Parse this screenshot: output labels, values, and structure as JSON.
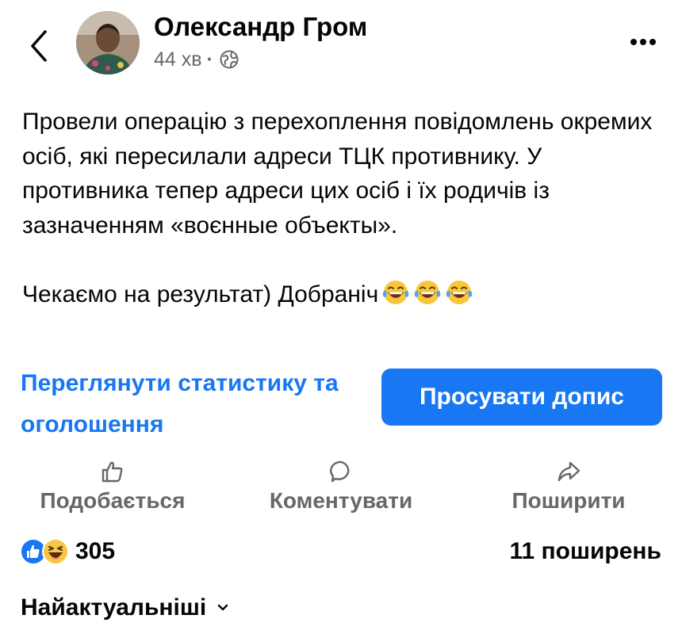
{
  "post": {
    "author": "Олександр Гром",
    "time": "44 хв",
    "paragraph1": "Провели операцію з перехоплення повідомлень окремих осіб, які пересилали адреси ТЦК противнику. У противника тепер адреси цих осіб і їх родичів із зазначенням «воєнные объекты».",
    "paragraph2": "Чекаємо на результат) Добраніч",
    "emojis": [
      "laugh-tears",
      "laugh-tears",
      "laugh-tears"
    ]
  },
  "promo": {
    "stats_link": "Переглянути статистику та оголошення",
    "promote_button": "Просувати допис"
  },
  "actions": {
    "like": "Подобається",
    "comment": "Коментувати",
    "share": "Поширити"
  },
  "engagement": {
    "reaction_icons": [
      "like-icon",
      "laugh-icon"
    ],
    "reaction_count": "305",
    "shares": "11 поширень"
  },
  "comments": {
    "sort_label": "Найактуальніші"
  },
  "colors": {
    "accent": "#1877f2",
    "secondary_text": "#65676b",
    "primary_text": "#050505"
  }
}
